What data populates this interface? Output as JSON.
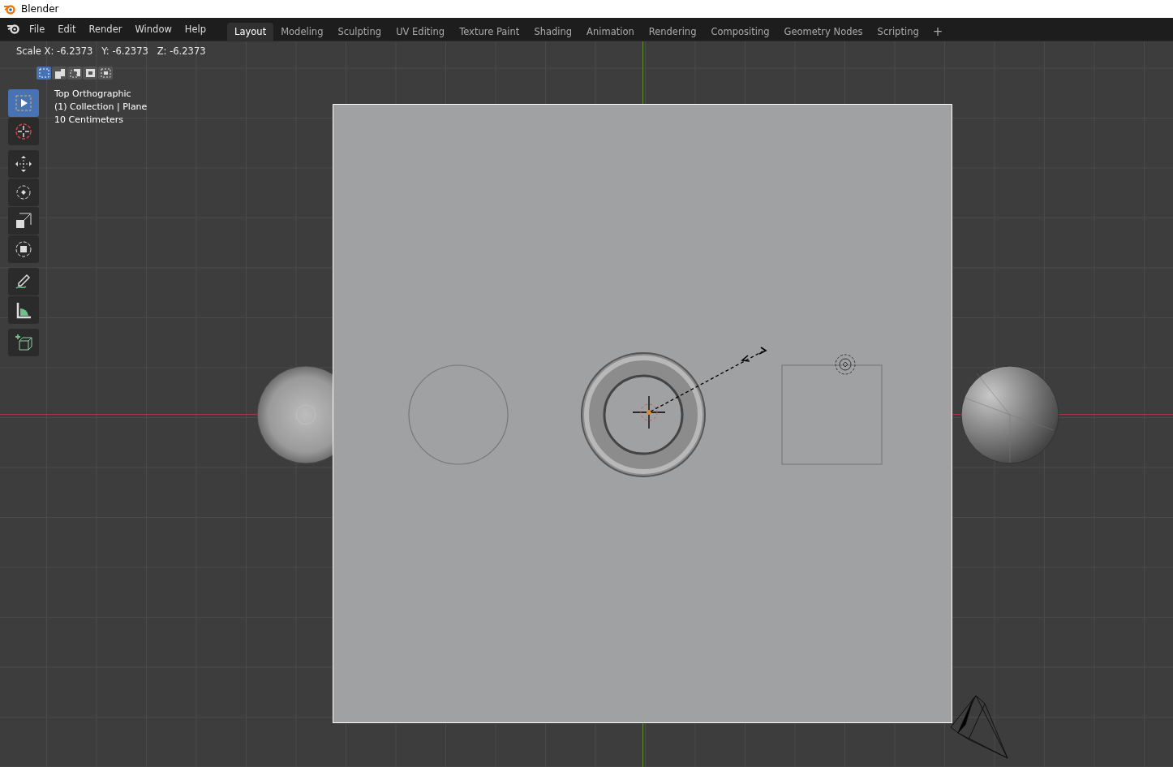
{
  "window": {
    "title": "Blender"
  },
  "menu": [
    "File",
    "Edit",
    "Render",
    "Window",
    "Help"
  ],
  "workspaces": [
    {
      "label": "Layout",
      "selected": true
    },
    {
      "label": "Modeling",
      "selected": false
    },
    {
      "label": "Sculpting",
      "selected": false
    },
    {
      "label": "UV Editing",
      "selected": false
    },
    {
      "label": "Texture Paint",
      "selected": false
    },
    {
      "label": "Shading",
      "selected": false
    },
    {
      "label": "Animation",
      "selected": false
    },
    {
      "label": "Rendering",
      "selected": false
    },
    {
      "label": "Compositing",
      "selected": false
    },
    {
      "label": "Geometry Nodes",
      "selected": false
    },
    {
      "label": "Scripting",
      "selected": false
    }
  ],
  "add_workspace": "+",
  "header": {
    "operator": "Scale X: -6.2373   Y: -6.2373   Z: -6.2373"
  },
  "select_modes": [
    {
      "kind": "new",
      "selected": true
    },
    {
      "kind": "extend",
      "selected": false
    },
    {
      "kind": "subtract",
      "selected": false
    },
    {
      "kind": "invert",
      "selected": false
    },
    {
      "kind": "intersect",
      "selected": false
    }
  ],
  "tool_groups": [
    [
      {
        "kind": "select",
        "selected": true
      },
      {
        "kind": "cursor",
        "selected": false
      }
    ],
    [
      {
        "kind": "move",
        "selected": false
      },
      {
        "kind": "rotate",
        "selected": false
      },
      {
        "kind": "scale",
        "selected": false
      },
      {
        "kind": "transform",
        "selected": false
      }
    ],
    [
      {
        "kind": "annotate",
        "selected": false
      },
      {
        "kind": "measure",
        "selected": false
      }
    ],
    [
      {
        "kind": "add-cube",
        "selected": false
      }
    ]
  ],
  "viewport": {
    "info": [
      "Top Orthographic",
      "(1) Collection | Plane",
      "10 Centimeters"
    ]
  }
}
